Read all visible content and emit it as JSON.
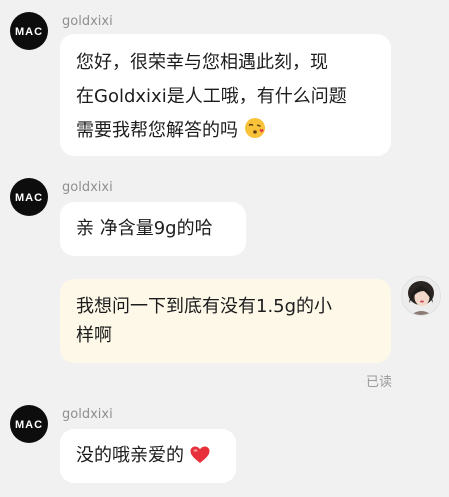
{
  "colors": {
    "background": "#f1f1f1",
    "incoming_bubble": "#ffffff",
    "outgoing_bubble": "#fdf8e8",
    "sender_name": "#8f8f8f",
    "avatar_brand": "#0d0d0d",
    "heart": "#e8303a"
  },
  "messages": [
    {
      "sender": "goldxixi",
      "lines": [
        "您好，很荣幸与您相遇此刻，现",
        "在Goldxixi是人工哦，有什么问题",
        "需要我帮您解答的吗"
      ],
      "emoji": "kissing-face-emoji"
    },
    {
      "sender": "goldxixi",
      "lines": [
        "亲 净含量9g的哈"
      ]
    },
    {
      "lines": [
        "我想问一下到底有没有1.5g的小",
        "样啊"
      ],
      "status": "已读"
    },
    {
      "sender": "goldxixi",
      "lines": [
        "没的哦亲爱的"
      ],
      "emoji": "red-heart-emoji"
    }
  ]
}
